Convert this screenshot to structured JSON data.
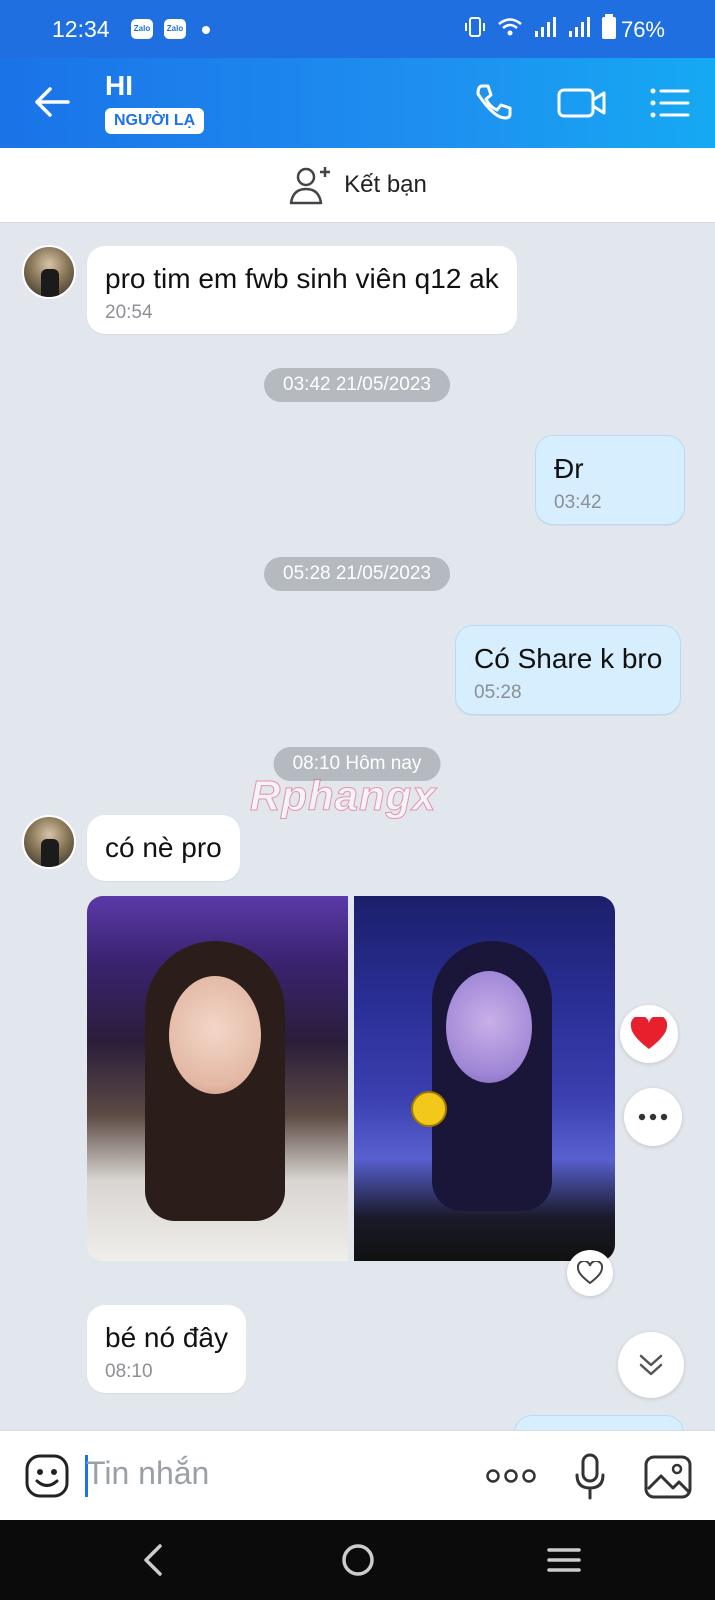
{
  "status_bar": {
    "time": "12:34",
    "app_icons": [
      "Zalo",
      "Zalo"
    ],
    "battery": "76%"
  },
  "header": {
    "title": "HI",
    "badge": "NGƯỜI LẠ"
  },
  "add_friend": {
    "label": "Kết bạn"
  },
  "messages": [
    {
      "text": "pro tim em fwb sinh viên q12 ak",
      "time": "20:54"
    },
    {
      "separator": "03:42 21/05/2023"
    },
    {
      "text": "Đr",
      "time": "03:42"
    },
    {
      "separator": "05:28 21/05/2023"
    },
    {
      "text": "Có Share k bro",
      "time": "05:28"
    },
    {
      "separator": "08:10 Hôm nay"
    },
    {
      "text": "có nè pro"
    },
    {
      "text": "bé nó đây",
      "time": "08:10"
    }
  ],
  "watermark": "Rphangx",
  "input": {
    "placeholder": "Tin nhắn"
  },
  "colors": {
    "header_blue": "#1a73e8",
    "chat_bg": "#e2e7ee",
    "my_bubble": "#d6eefd",
    "heart_red": "#e8202e"
  }
}
